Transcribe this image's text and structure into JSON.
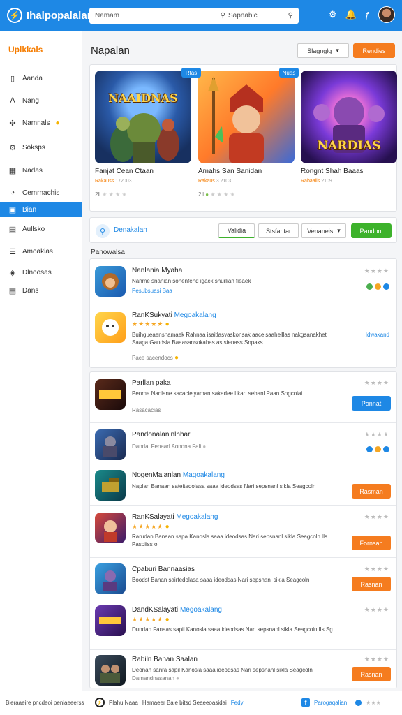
{
  "header": {
    "brand": "Ihalpopalalan",
    "search_placeholder": "Namam",
    "search_middle": "Sapnabic"
  },
  "sidebar": {
    "title": "Uplkkals",
    "items": [
      {
        "label": "Aanda",
        "icon": "tablet-icon"
      },
      {
        "label": "Nang",
        "icon": "a-letter-icon"
      },
      {
        "label": "Namnals",
        "icon": "puzzle-icon",
        "coin": true
      },
      {
        "label": "Soksps",
        "icon": "gear-icon"
      },
      {
        "label": "Nadas",
        "icon": "grid-icon"
      },
      {
        "label": "Cemrnachis",
        "icon": "chat-icon"
      },
      {
        "label": "Bian",
        "icon": "monitor-icon",
        "active": true
      },
      {
        "label": "Aullsko",
        "icon": "box-icon"
      },
      {
        "label": "Amoakias",
        "icon": "list-icon"
      },
      {
        "label": "Dlnoosas",
        "icon": "shield-icon"
      },
      {
        "label": "Dans",
        "icon": "doc-icon"
      }
    ]
  },
  "main": {
    "title": "Napalan",
    "sort_dropdown": "Slagnglg",
    "top_button": "Rendies"
  },
  "featured": [
    {
      "name": "Fanjat Cean Ctaan",
      "sub": "Rakauss",
      "price": "172003",
      "rating": "2ll",
      "badge": "Rtas",
      "art_title": "NAAIDNAS",
      "palette": "blue"
    },
    {
      "name": "Amahs San Sanidan",
      "sub": "Rakaus",
      "price": "3 2103",
      "rating": "2ll",
      "badge": "Nuas",
      "art_title": "",
      "palette": "orange"
    },
    {
      "name": "Rongnt Shah Baaas",
      "sub": "Rabaalls",
      "price": "2109",
      "rating": "1ll",
      "badge": "",
      "art_title": "NARDIAS",
      "palette": "purple"
    }
  ],
  "filters": {
    "label": "Denakalan",
    "chip1": "Validia",
    "chip2": "Stsfantar",
    "chip3": "Venaneis",
    "apply": "Pandoni"
  },
  "section_label": "Panowalsa",
  "list_card1": [
    {
      "title": "Nanlania Myaha",
      "tag": "",
      "desc": "Nanme snanian sonenfend igack shurlian fieaek",
      "sub": "Pesubsuasi",
      "sub_blue": "Baa",
      "icon_palette": "monkey"
    },
    {
      "title": "RanKSukyati",
      "tag": "Megoakalang",
      "desc": "Buihgueaensnamaek Rahnaa isaitlasvaskonsak aacelsaahelllas nakgsanakhet Saaga Gandsla Baaasansokahas as sienass Snpaks",
      "sub": "Pace sacendocs",
      "link": "Idwakand",
      "icon_palette": "ghost"
    }
  ],
  "list_card2": [
    {
      "title": "Parllan paka",
      "tag": "",
      "desc": "Penme Nanlane sacacielyaman sakadee l kart sehanl Paan Sngcolai",
      "sub": "Rasacacias",
      "button": "Ponnat",
      "btn_color": "blue",
      "icon_palette": "title-art"
    },
    {
      "title": "Pandonalanlnlhhar",
      "tag": "",
      "desc": "Dandal Fenaarl Aondna",
      "sub": "Fali",
      "icon_palette": "warrior"
    },
    {
      "title": "NogenMalanlan",
      "tag": "Magoakalang",
      "desc": "Naplan Banaan sateitedolasa saaa ideodsas Nari sepsnanl sikla Seagcoln",
      "sub": "",
      "button": "Rasman",
      "btn_color": "orange",
      "icon_palette": "tank"
    },
    {
      "title": "RanKSalayati",
      "tag": "Megoakalang",
      "desc": "Rarudan Banaan sapa Kanosla saaa ideodsas Nari sepsnanl sikla Seagcoln lIs Pasoiiss oi",
      "sub": "",
      "button": "Fornsan",
      "btn_color": "orange",
      "icon_palette": "hero"
    },
    {
      "title": "Cpaburi Bannaasias",
      "tag": "",
      "desc": "Boodst Banan sairtedolasa saaa ideodsas Nari sepsnanl sikla Seagcoln",
      "sub": "",
      "button": "Rasnan",
      "btn_color": "orange",
      "icon_palette": "knight"
    },
    {
      "title": "DandKSalayati",
      "tag": "Megoakalang",
      "desc": "Dundan Fanaas sapil Kanosla saaa ideodsas Nari sepsnanl sikla Seagcoln lIs Sg",
      "sub": "",
      "icon_palette": "title-art2"
    },
    {
      "title": "Rabiln Banan Saalan",
      "tag": "",
      "desc": "Deonan sanra sapil Kanosla saaa ideodsas Nari sepsnanl sikla Seagcoln",
      "sub": "Damandnasanan",
      "button": "Rasnan",
      "btn_color": "orange",
      "icon_palette": "soldiers"
    }
  ],
  "footer": {
    "left": "Bieraaeire pncdeoi peniaeeerss",
    "mid_brand": "Plahu Naaa",
    "mid_text": "Hamaeer Bale bitsd Seaeeoasidai",
    "mid_blue": "Fedy",
    "right": "Parogaqalian"
  },
  "colors": {
    "accent_blue": "#1e88e5",
    "accent_orange": "#f57c1f",
    "accent_green": "#3db22b"
  }
}
